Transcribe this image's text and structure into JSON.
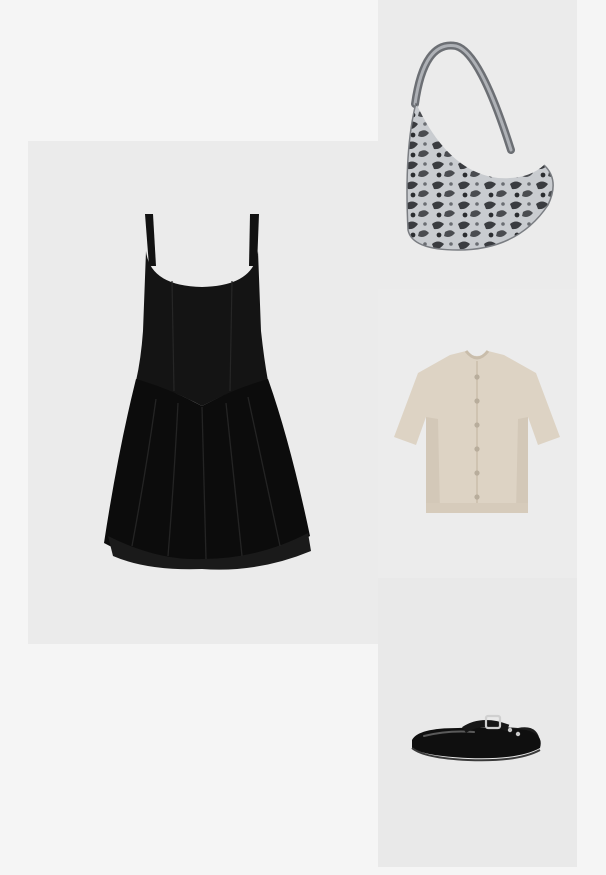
{
  "board": {
    "background_color": "#f5f5f5",
    "tile_color": "#ebebeb"
  },
  "items": [
    {
      "id": "dress",
      "image": "black-sleeveless-drop-waist-mini-dress",
      "color": "#0d0d0d"
    },
    {
      "id": "bag",
      "image": "snakeskin-print-shoulder-bag",
      "color": "#8a8d92"
    },
    {
      "id": "cardigan",
      "image": "beige-short-sleeve-knit-cardigan",
      "color": "#ddd3c4"
    },
    {
      "id": "shoes",
      "image": "black-buckle-ballet-flats",
      "color": "#111111"
    }
  ]
}
